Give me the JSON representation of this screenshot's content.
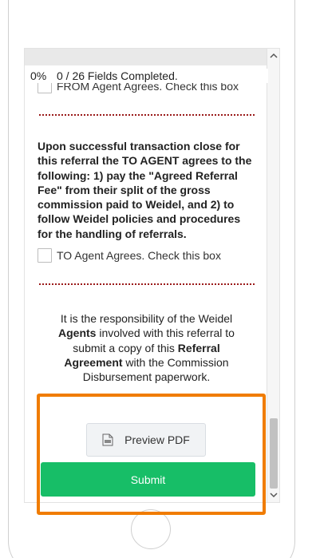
{
  "progress": {
    "percent_label": "0%",
    "fields_text": "0 / 26 Fields Completed."
  },
  "from_agent": {
    "checkbox_label": "FROM Agent Agrees. Check this box",
    "checked": false
  },
  "agreement_text": "Upon successful transaction close for this referral the TO AGENT agrees to the following: 1) pay the \"Agreed Referral Fee\" from their split of the gross commission paid to Weidel, and 2) to follow Weidel policies and procedures for the handling of referrals.",
  "to_agent": {
    "checkbox_label": "TO Agent Agrees. Check this box",
    "checked": false
  },
  "responsibility": {
    "part1": "It is the responsibility of the Weidel ",
    "bold1": "Agents",
    "part2": " involved with this referral to submit a copy of this ",
    "bold2": "Referral Agreement",
    "part3": " with the Commission Disbursement paperwork."
  },
  "actions": {
    "preview_label": "Preview PDF",
    "submit_label": "Submit"
  },
  "icons": {
    "preview": "pdf-file-icon",
    "scroll_up": "chevron-up-icon",
    "scroll_down": "chevron-down-icon"
  },
  "colors": {
    "submit_bg": "#17be67",
    "highlight": "#f07c00",
    "divider": "#9a1a1a"
  }
}
